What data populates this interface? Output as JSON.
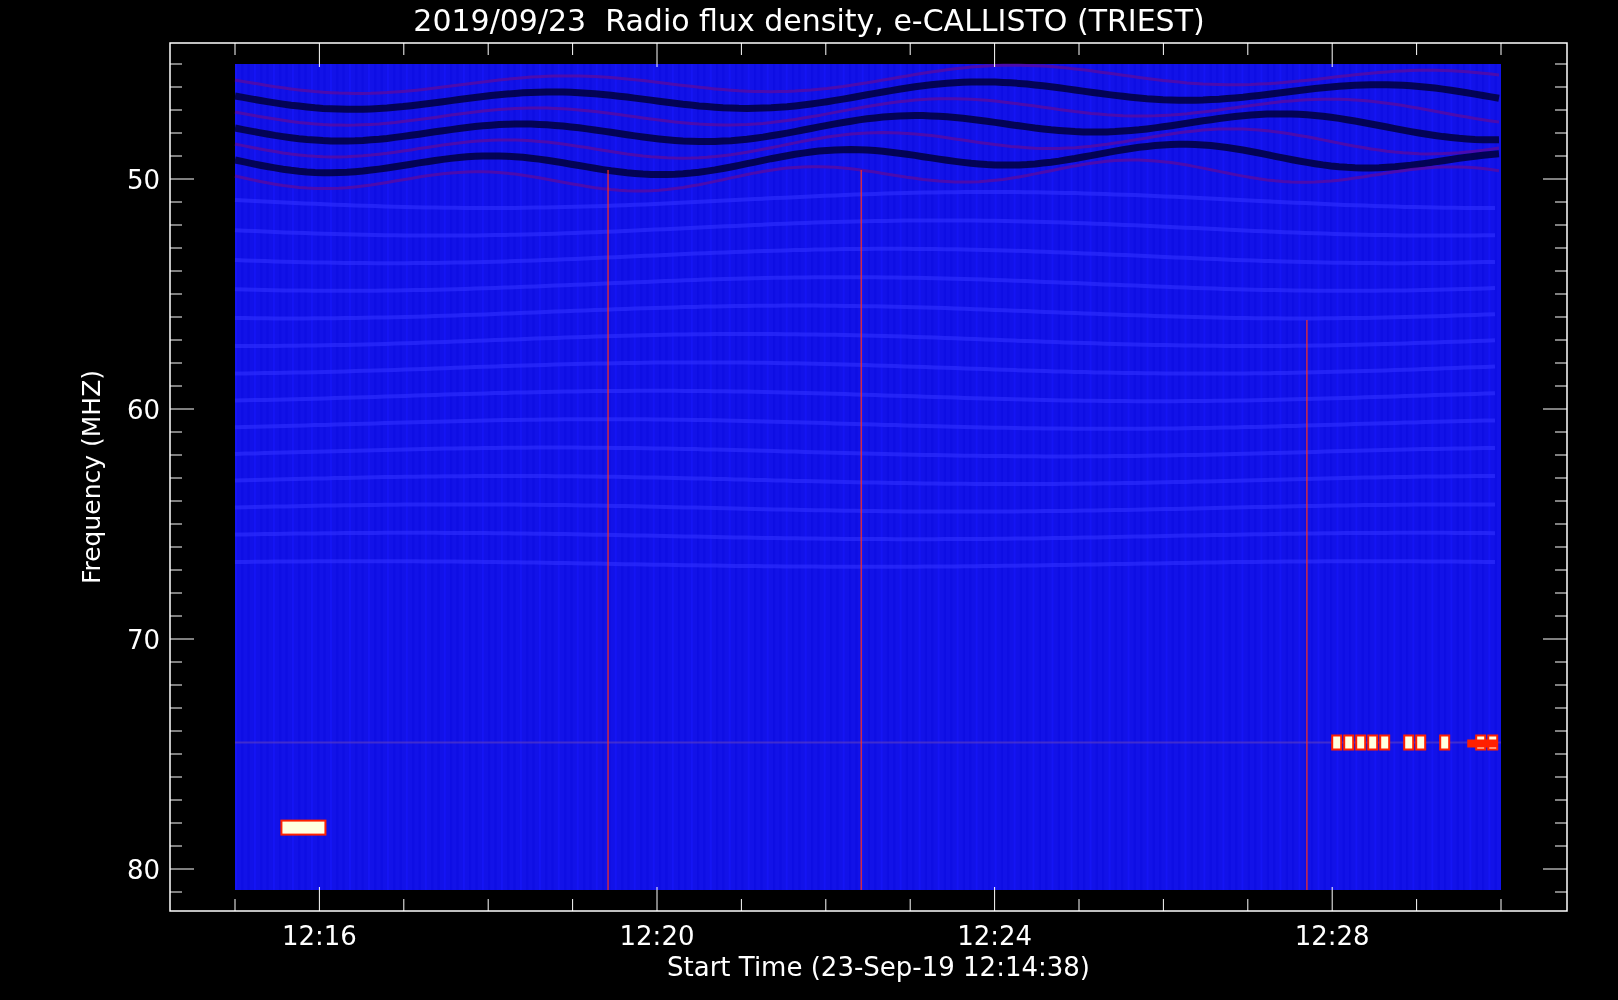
{
  "title": "2019/09/23  Radio flux density, e-CALLISTO (TRIEST)",
  "ylabel": "Frequency (MHZ)",
  "xlabel": "Start Time (23-Sep-19 12:14:38)",
  "xticks": [
    "12:16",
    "12:20",
    "12:24",
    "12:28"
  ],
  "yticks": [
    "50",
    "60",
    "70",
    "80"
  ]
}
